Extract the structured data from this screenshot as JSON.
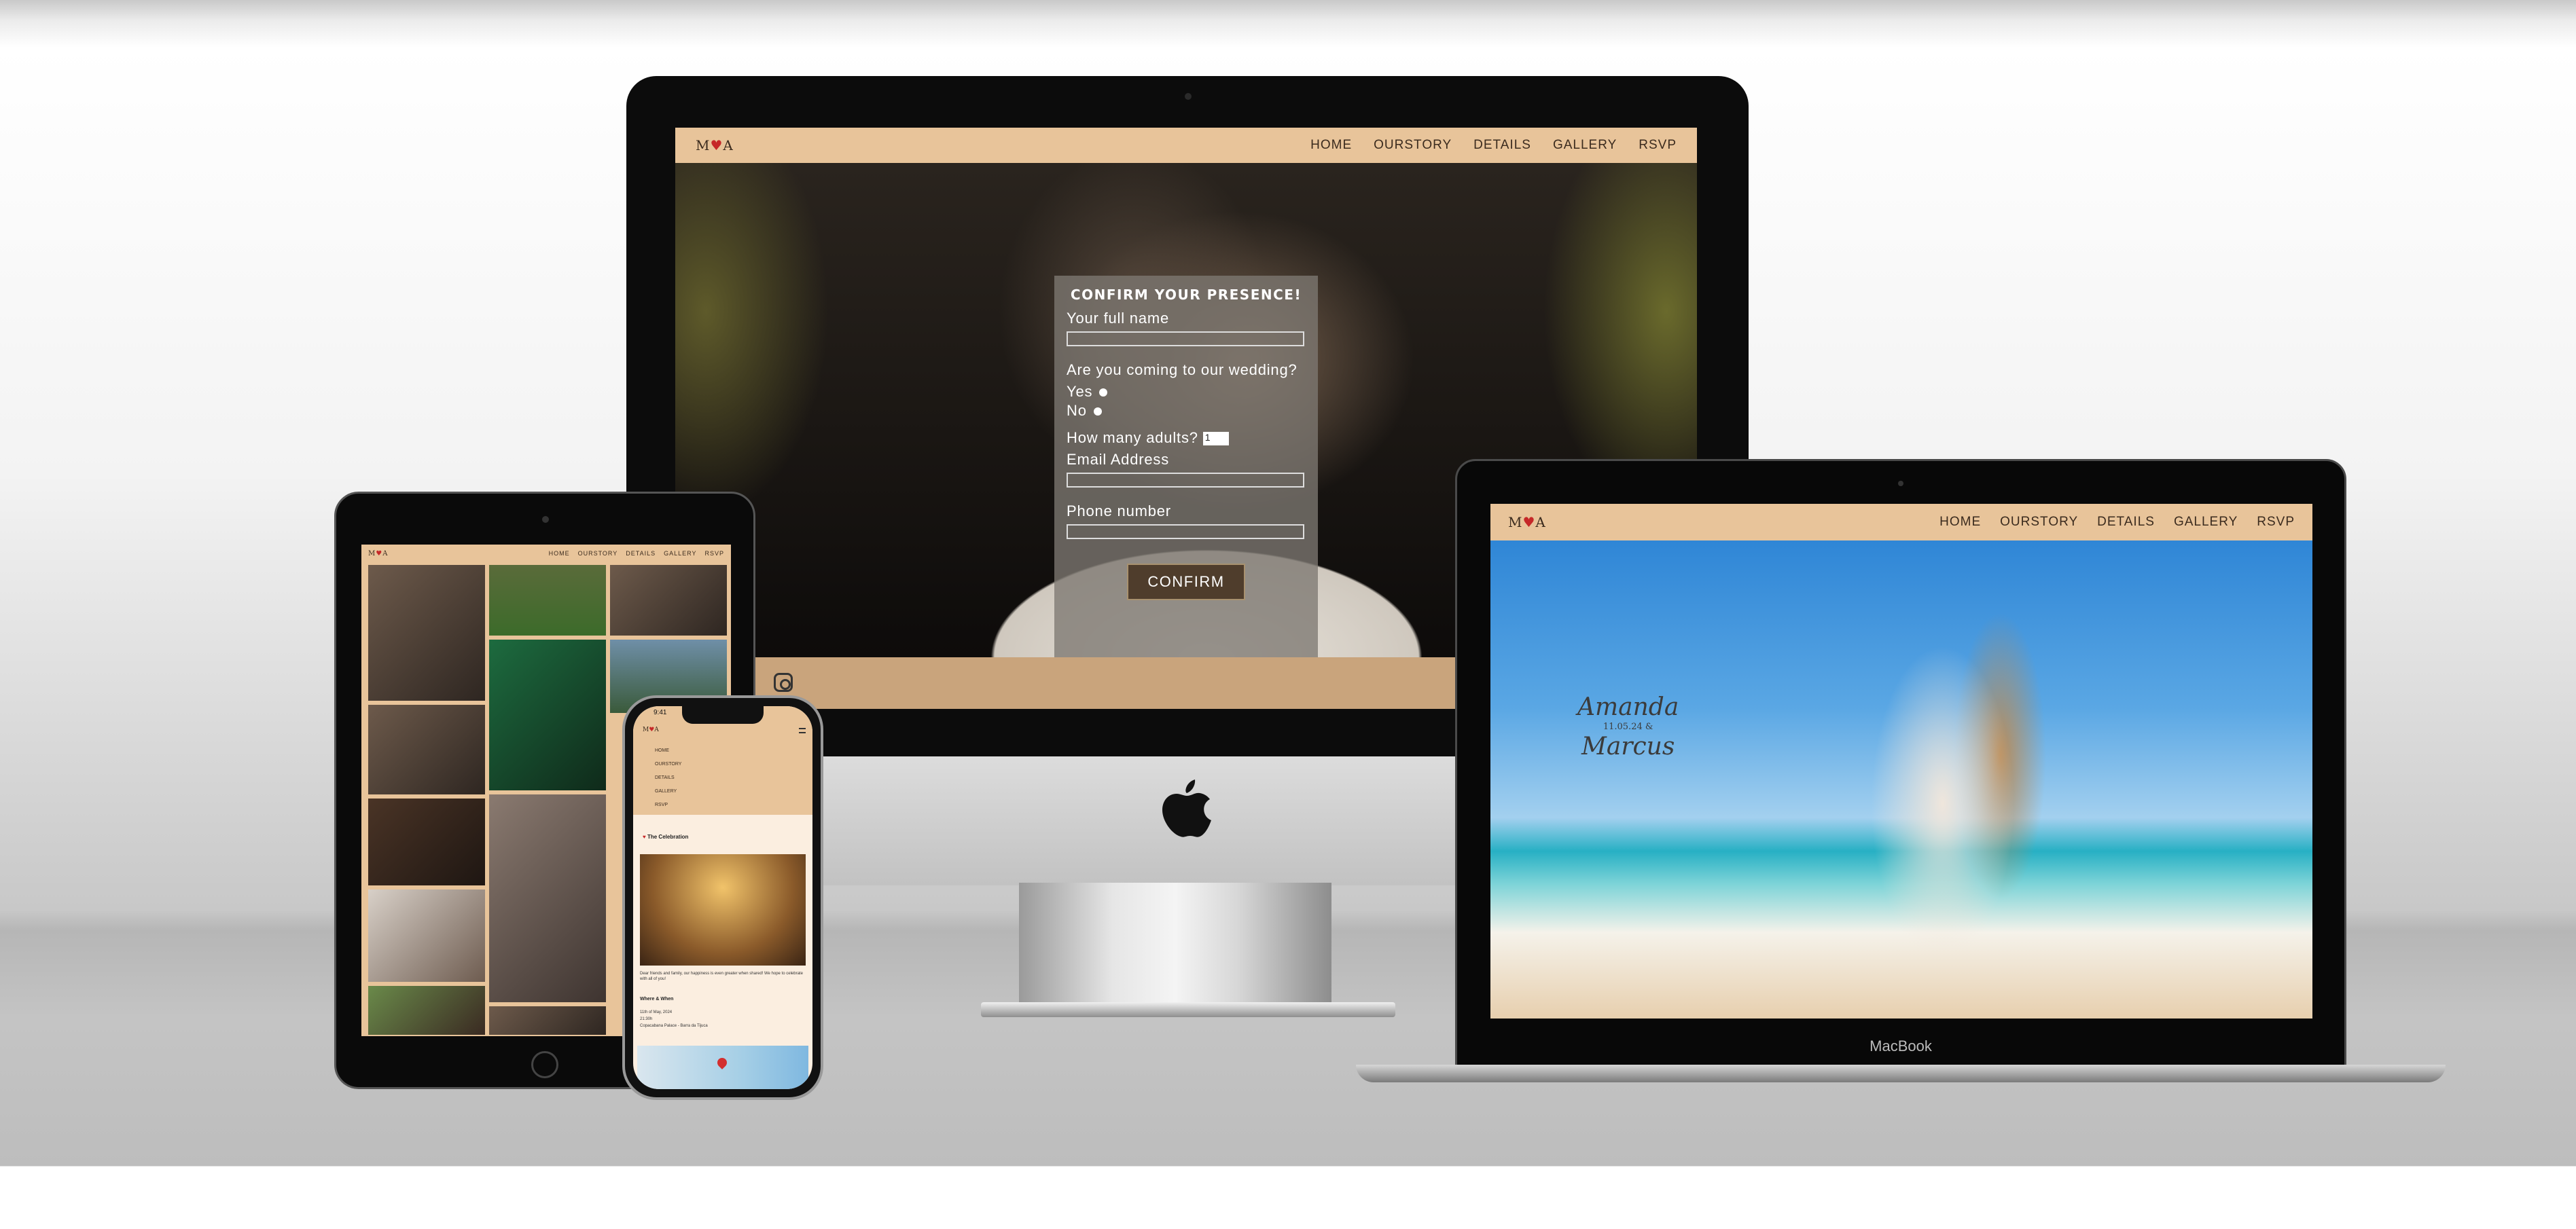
{
  "site": {
    "logo_left": "M",
    "logo_heart": "♥",
    "logo_right": "A",
    "nav": [
      "HOME",
      "OURSTORY",
      "DETAILS",
      "GALLERY",
      "RSVP"
    ]
  },
  "rsvp": {
    "title": "CONFIRM YOUR PRESENCE!",
    "name_label": "Your full name",
    "coming_label": "Are you coming to our wedding?",
    "yes": "Yes",
    "no": "No",
    "adults_label": "How many adults?",
    "adults_value": "1",
    "email_label": "Email Address",
    "phone_label": "Phone number",
    "confirm": "CONFIRM"
  },
  "hero": {
    "name1": "Amanda",
    "date": "11.05.24",
    "amp": "&",
    "name2": "Marcus"
  },
  "macbook_label": "MacBook",
  "phone": {
    "time": "9:41",
    "menu": [
      "HOME",
      "OURSTORY",
      "DETAILS",
      "GALLERY",
      "RSVP"
    ],
    "section_title": "The Celebration",
    "body": "Dear friends and family, our happiness is even greater when shared! We hope to celebrate with all of you!",
    "where_title": "Where & When",
    "date": "11th of May, 2024",
    "time_text": "21:30h",
    "venue": "Copacabana Palace - Barra da Tijuca"
  },
  "icons": [
    "instagram-icon",
    "apple-logo-icon",
    "heart-icon",
    "hamburger-icon",
    "map-pin-icon"
  ]
}
